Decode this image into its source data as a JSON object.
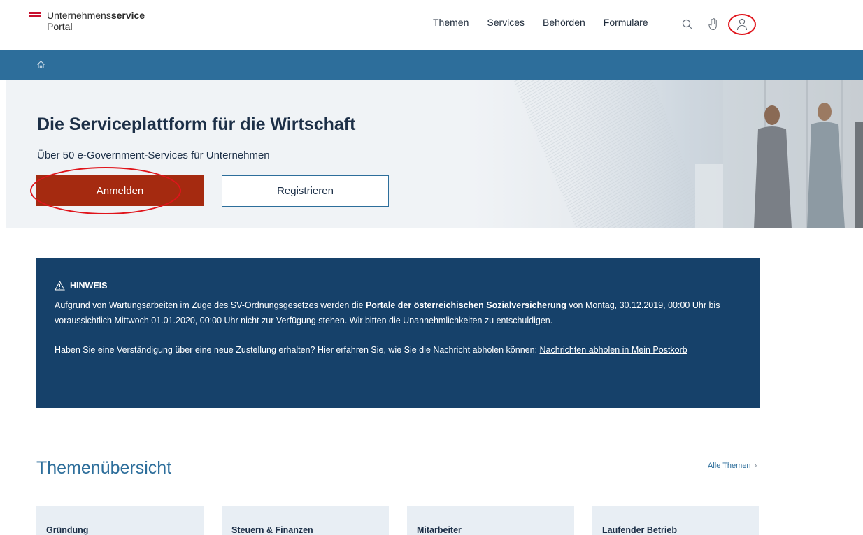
{
  "header": {
    "logo_line1_plain": "Unternehmens",
    "logo_line1_bold": "service",
    "logo_line2": "Portal",
    "nav": [
      "Themen",
      "Services",
      "Behörden",
      "Formulare"
    ],
    "icons": [
      "search-icon",
      "hand-icon",
      "user-icon"
    ]
  },
  "breadcrumb": {
    "icon": "home-icon"
  },
  "hero": {
    "title": "Die Serviceplattform für die Wirtschaft",
    "subtitle": "Über 50 e-Government-Services für Unternehmen",
    "login_label": "Anmelden",
    "register_label": "Registrieren"
  },
  "notice": {
    "heading": "HINWEIS",
    "p1_before": "Aufgrund von Wartungsarbeiten im Zuge des SV-Ordnungsgesetzes werden die ",
    "p1_bold": "Portale der österreichischen Sozialversicherung",
    "p1_after": " von Montag, 30.12.2019, 00:00 Uhr bis voraussichtlich Mittwoch 01.01.2020, 00:00 Uhr nicht zur Verfügung stehen. Wir bitten die Unannehmlichkeiten zu entschuldigen.",
    "p2_before": "Haben Sie eine Verständigung über eine neue Zustellung erhalten? Hier erfahren Sie, wie Sie die Nachricht abholen können: ",
    "p2_link": "Nachrichten abholen in Mein Postkorb"
  },
  "themen": {
    "title": "Themenübersicht",
    "all_link": "Alle Themen",
    "all_chevron": "›",
    "cards": [
      "Gründung",
      "Steuern & Finanzen",
      "Mitarbeiter",
      "Laufender Betrieb"
    ]
  },
  "colors": {
    "brand_blue": "#2d6e9b",
    "notice_bg": "#16416a",
    "login_bg": "#a52a10",
    "annotation_red": "#e0141b"
  }
}
